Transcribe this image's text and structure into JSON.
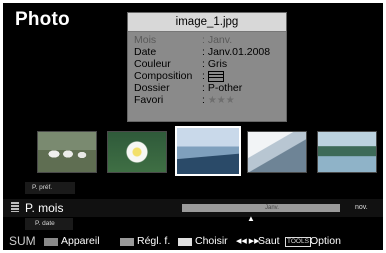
{
  "app": {
    "title": "Photo"
  },
  "info": {
    "filename": "image_1.jpg",
    "rows": [
      {
        "key": "Mois",
        "value": ": Janv."
      },
      {
        "key": "Date",
        "value": ": Janv.01.2008"
      },
      {
        "key": "Couleur",
        "value": ": Gris"
      },
      {
        "key": "Composition",
        "value": ":"
      },
      {
        "key": "Dossier",
        "value": ": P-other"
      },
      {
        "key": "Favori",
        "value": ":"
      }
    ],
    "favori_stars": "★★★"
  },
  "thumbnails": [
    {
      "name": "sheep"
    },
    {
      "name": "flower"
    },
    {
      "name": "sea",
      "selected": true
    },
    {
      "name": "snow-mountain"
    },
    {
      "name": "lake-island"
    }
  ],
  "sort": {
    "prev": "P. préf.",
    "current": "P. mois",
    "next_option": "P. date",
    "timeline_label": "Janv.",
    "timeline_next": "nov."
  },
  "footer": {
    "sum": "SUM",
    "appareil": "Appareil",
    "reglf": "Régl. f.",
    "choisir": "Choisir",
    "saut_arrows": "◀◀ ▶▶",
    "saut": "Saut",
    "tools": "TOOLS",
    "option": "Option"
  }
}
